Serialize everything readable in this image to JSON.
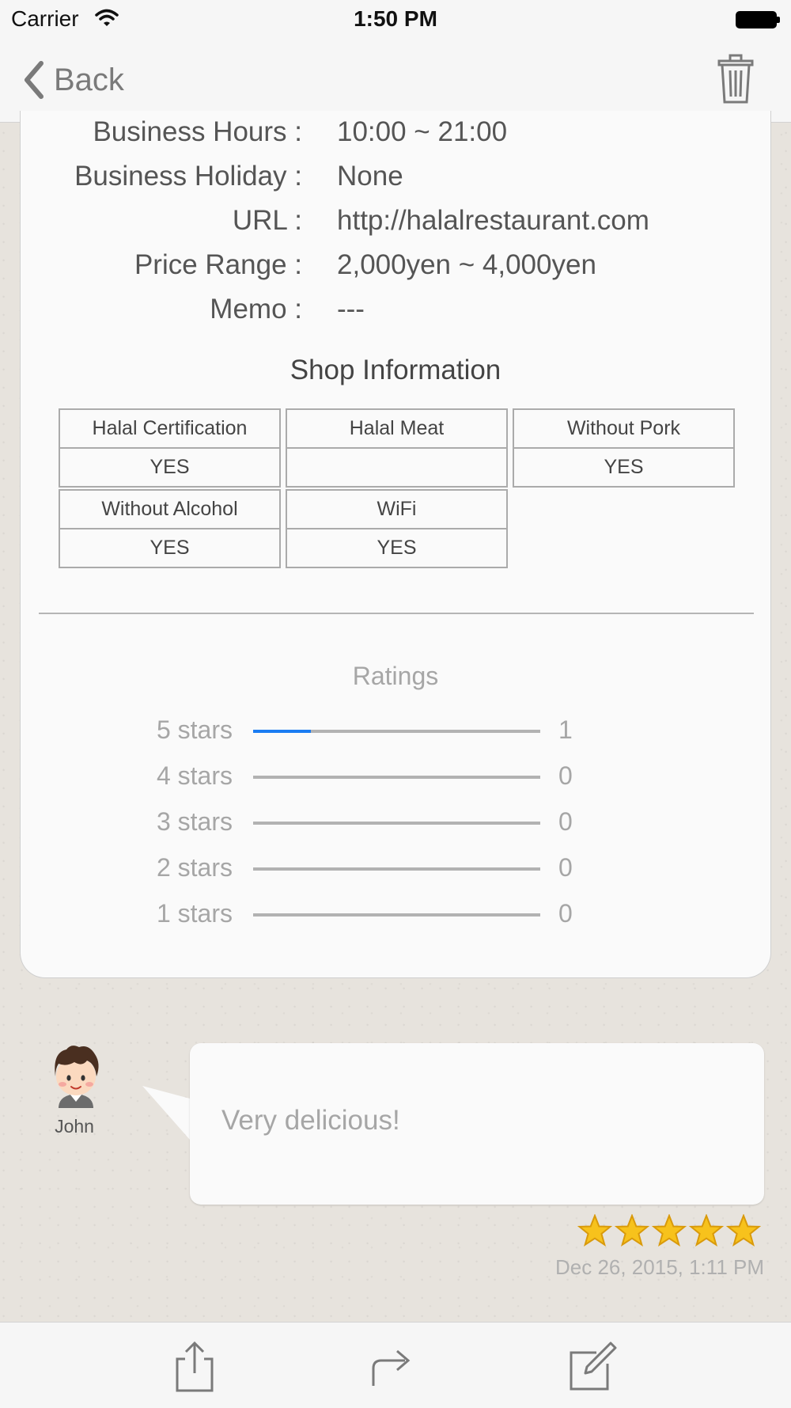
{
  "status_bar": {
    "carrier": "Carrier",
    "time": "1:50 PM"
  },
  "nav": {
    "back_label": "Back"
  },
  "details": [
    {
      "label": "Business Hours :",
      "value": "10:00 ~ 21:00"
    },
    {
      "label": "Business Holiday :",
      "value": "None"
    },
    {
      "label": "URL :",
      "value": "http://halalrestaurant.com"
    },
    {
      "label": "Price Range :",
      "value": "2,000yen ~ 4,000yen"
    },
    {
      "label": "Memo :",
      "value": "---"
    }
  ],
  "shop_info": {
    "title": "Shop Information",
    "items": [
      {
        "name": "Halal Certification",
        "value": "YES"
      },
      {
        "name": "Halal Meat",
        "value": ""
      },
      {
        "name": "Without Pork",
        "value": "YES"
      },
      {
        "name": "Without Alcohol",
        "value": "YES"
      },
      {
        "name": "WiFi",
        "value": "YES"
      }
    ]
  },
  "ratings": {
    "title": "Ratings",
    "rows": [
      {
        "label": "5 stars",
        "count": "1",
        "fill_fraction": 0.2
      },
      {
        "label": "4 stars",
        "count": "0",
        "fill_fraction": 0
      },
      {
        "label": "3 stars",
        "count": "0",
        "fill_fraction": 0
      },
      {
        "label": "2 stars",
        "count": "0",
        "fill_fraction": 0
      },
      {
        "label": "1 stars",
        "count": "0",
        "fill_fraction": 0
      }
    ]
  },
  "review": {
    "user": "John",
    "comment": "Very delicious!",
    "rating": 5,
    "date": "Dec 26, 2015, 1:11 PM"
  },
  "colors": {
    "accent": "#1a7cf2",
    "star": "#f7c21c"
  },
  "toolbar": {
    "icons": [
      "share-icon",
      "forward-icon",
      "compose-icon"
    ]
  }
}
